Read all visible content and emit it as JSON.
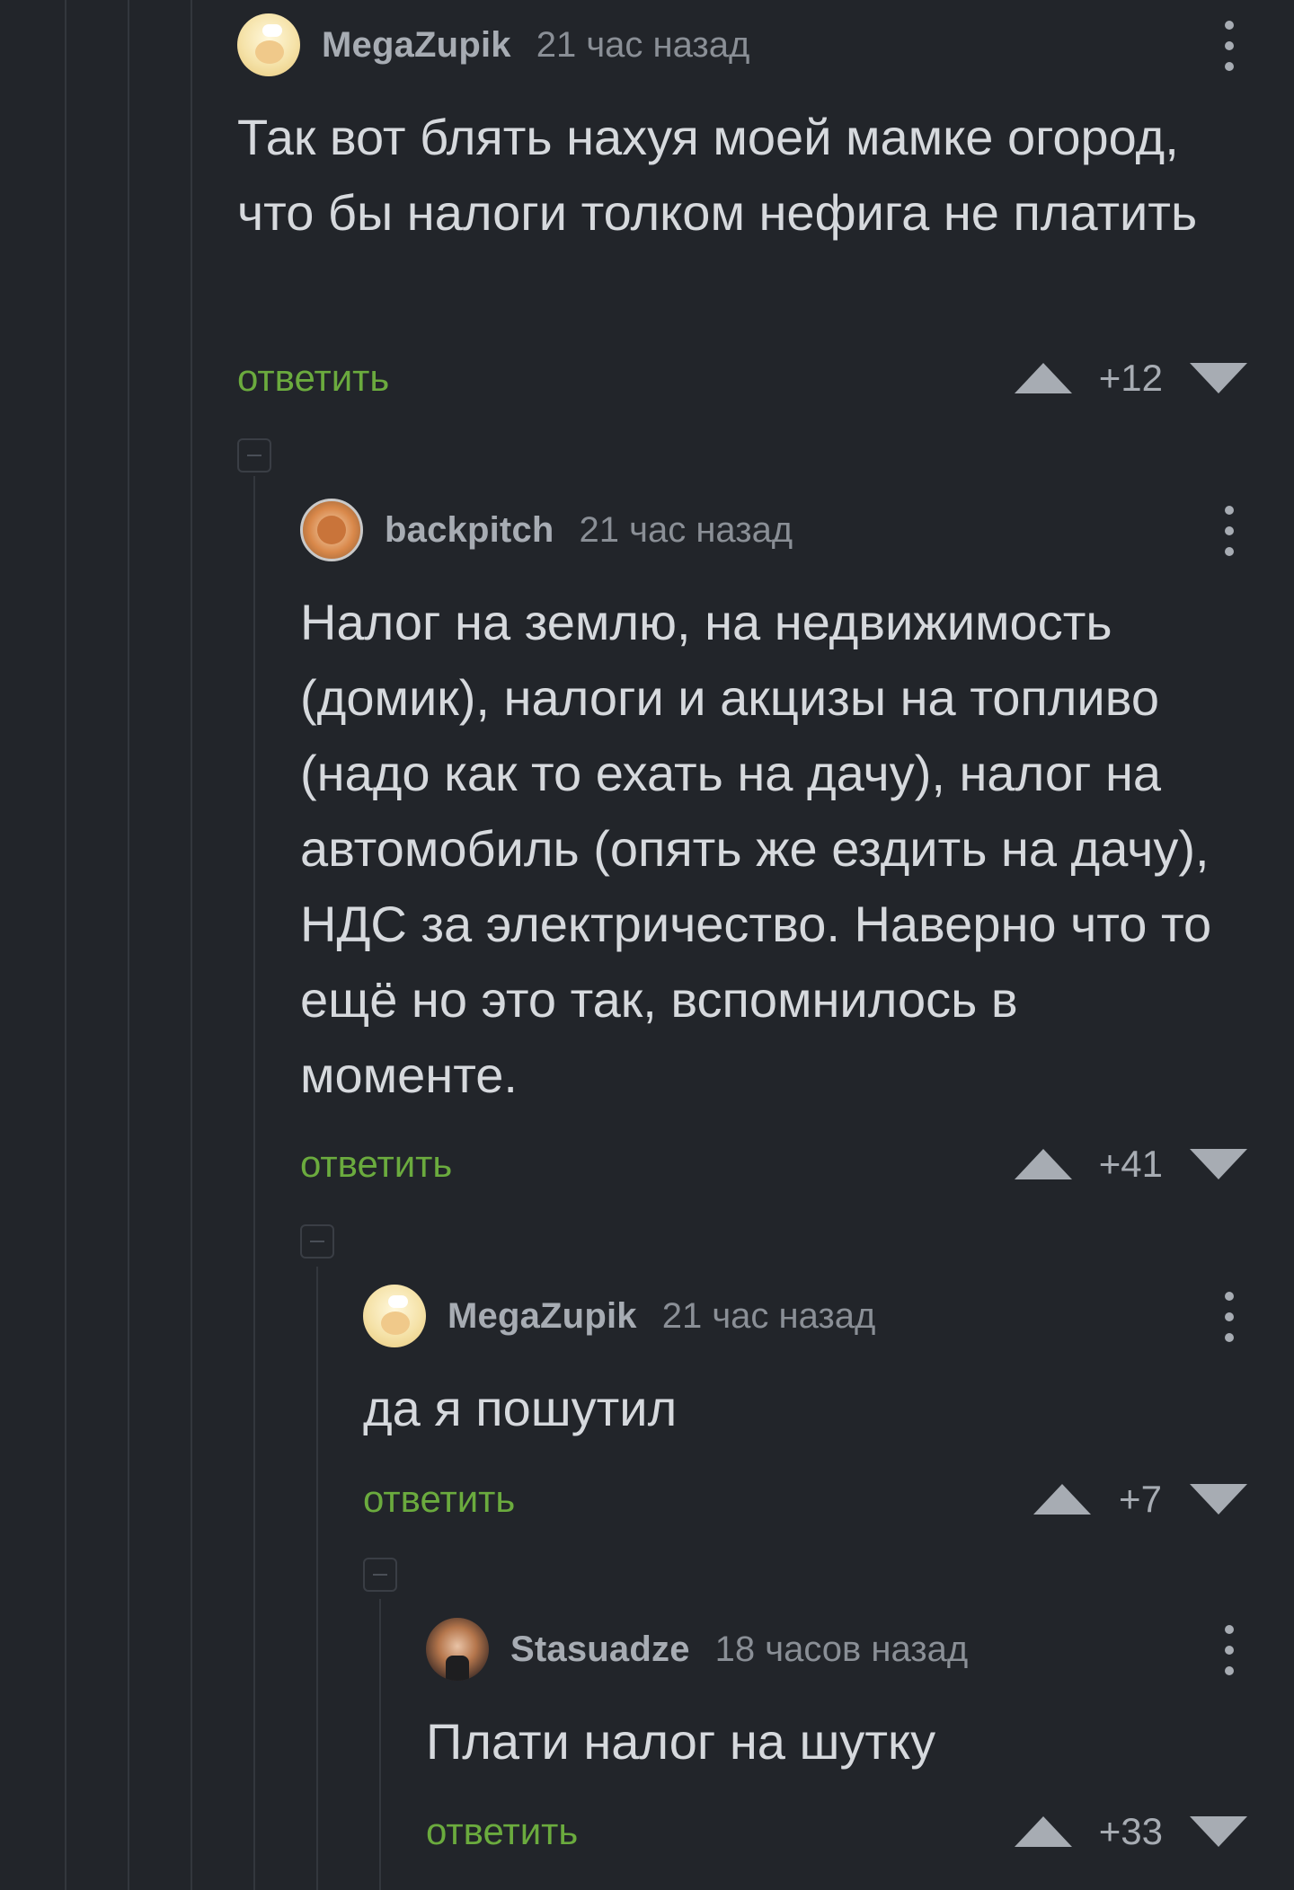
{
  "comments": [
    {
      "username": "MegaZupik",
      "time": "21 час назад",
      "avatar": "cream-avatar",
      "text": "Так вот блять нахуя моей мамке огород, что бы налоги толком нефига не платить",
      "reply_label": "ответить",
      "score": "+12"
    },
    {
      "username": "backpitch",
      "time": "21 час назад",
      "avatar": "orange-avatar",
      "text": "Налог на землю, на недвижимость (домик), налоги и акцизы на топливо (надо как то ехать на дачу), налог на автомобиль (опять же ездить на дачу), НДС за электричество. Наверно что то ещё но это так, вспомнилось в моменте.",
      "reply_label": "ответить",
      "score": "+41"
    },
    {
      "username": "MegaZupik",
      "time": "21 час назад",
      "avatar": "cream-avatar",
      "text": "да я пошутил",
      "reply_label": "ответить",
      "score": "+7"
    },
    {
      "username": "Stasuadze",
      "time": "18 часов назад",
      "avatar": "dark-avatar",
      "text": "Плати налог на шутку",
      "reply_label": "ответить",
      "score": "+33"
    }
  ],
  "colors": {
    "background": "#22252a",
    "reply_link": "#6bab3e",
    "text": "#d6d9dd",
    "meta": "#8a8f96"
  },
  "icons": [
    "more-vertical-icon",
    "upvote-arrow-icon",
    "downvote-arrow-icon",
    "collapse-icon"
  ]
}
